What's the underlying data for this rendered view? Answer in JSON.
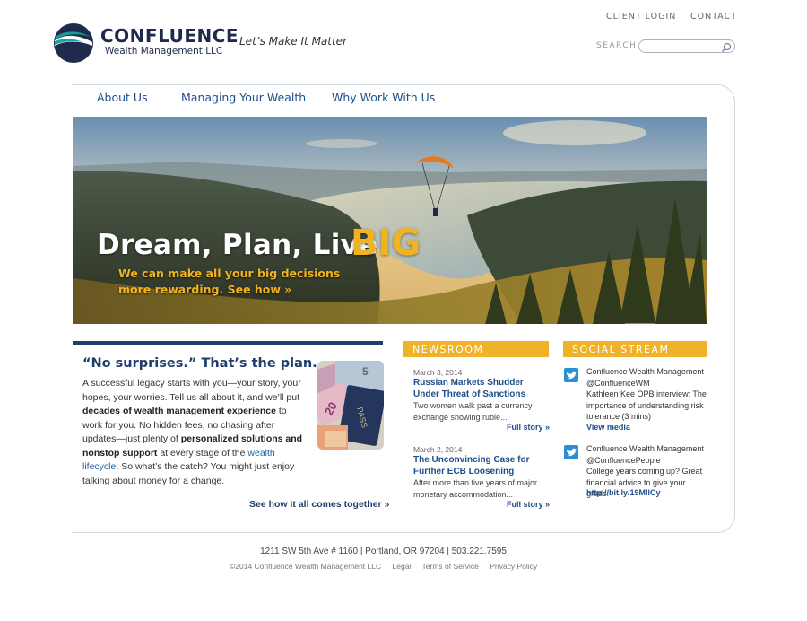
{
  "header": {
    "brand_name": "CONFLUENCE",
    "brand_sub": "Wealth Management LLC",
    "tagline": "Let’s Make It Matter",
    "client_login": "CLIENT LOGIN",
    "contact": "CONTACT",
    "search_label": "SEARCH",
    "search_value": ""
  },
  "nav": {
    "items": [
      "About Us",
      "Managing Your Wealth",
      "Why Work With Us"
    ]
  },
  "hero": {
    "title": "Dream, Plan, Live",
    "title_big": "BIG",
    "sub_line1": "We can make all your big decisions",
    "sub_line2": "more rewarding.",
    "sub_link": "See how »"
  },
  "intro": {
    "heading": "“No surprises.” That’s the plan.",
    "p1": "A successful legacy starts with you—your story, your hopes, your worries. Tell us all about it, and we’ll put ",
    "b1": "decades of wealth management experience",
    "p2": " to work for you. No hidden fees, no chasing after updates—just plenty of ",
    "b2": "personalized solutions and nonstop support",
    "p3": " at every stage of the ",
    "link": "wealth lifecycle",
    "p4": ". So what’s the catch? You might just enjoy talking about money for a change.",
    "see_how": "See how it all comes together »"
  },
  "newsroom": {
    "heading": "NEWSROOM",
    "items": [
      {
        "date": "March 3, 2014",
        "title": "Russian Markets Shudder Under Threat of Sanctions",
        "desc": "Two women walk past a currency exchange showing ruble...",
        "more": "Full story »"
      },
      {
        "date": "March 2, 2014",
        "title": "The Unconvincing Case for Further ECB Loosening",
        "desc": "After more than five years of major monetary accommodation...",
        "more": "Full story »"
      }
    ]
  },
  "social": {
    "heading": "SOCIAL STREAM",
    "items": [
      {
        "name": "Confluence Wealth Management",
        "handle": "@ConfluenceWM",
        "text": "Kathleen Kee OPB interview: The importance of understanding risk tolerance (3 mins)",
        "link": "View media"
      },
      {
        "name": "Confluence Wealth Management",
        "handle": "@ConfluencePeople",
        "text": "College years coming up? Great financial advice to give your grads:",
        "link": "http://bit.ly/19MIlCy"
      }
    ]
  },
  "footer": {
    "address": "1211 SW 5th Ave # 1160 | Portland, OR 97204 | 503.221.7595",
    "copyright": "©2014 Confluence Wealth Management LLC",
    "links": [
      "Legal",
      "Terms of Service",
      "Privacy Policy"
    ]
  },
  "colors": {
    "navy": "#1f3e6e",
    "link_blue": "#1f4e8c",
    "gold": "#f0b22b",
    "teal": "#1aa6a3",
    "twitter": "#2b8fd6"
  },
  "icons": {
    "logo": "confluence-logo-icon",
    "search": "search-icon",
    "twitter": "twitter-icon"
  }
}
